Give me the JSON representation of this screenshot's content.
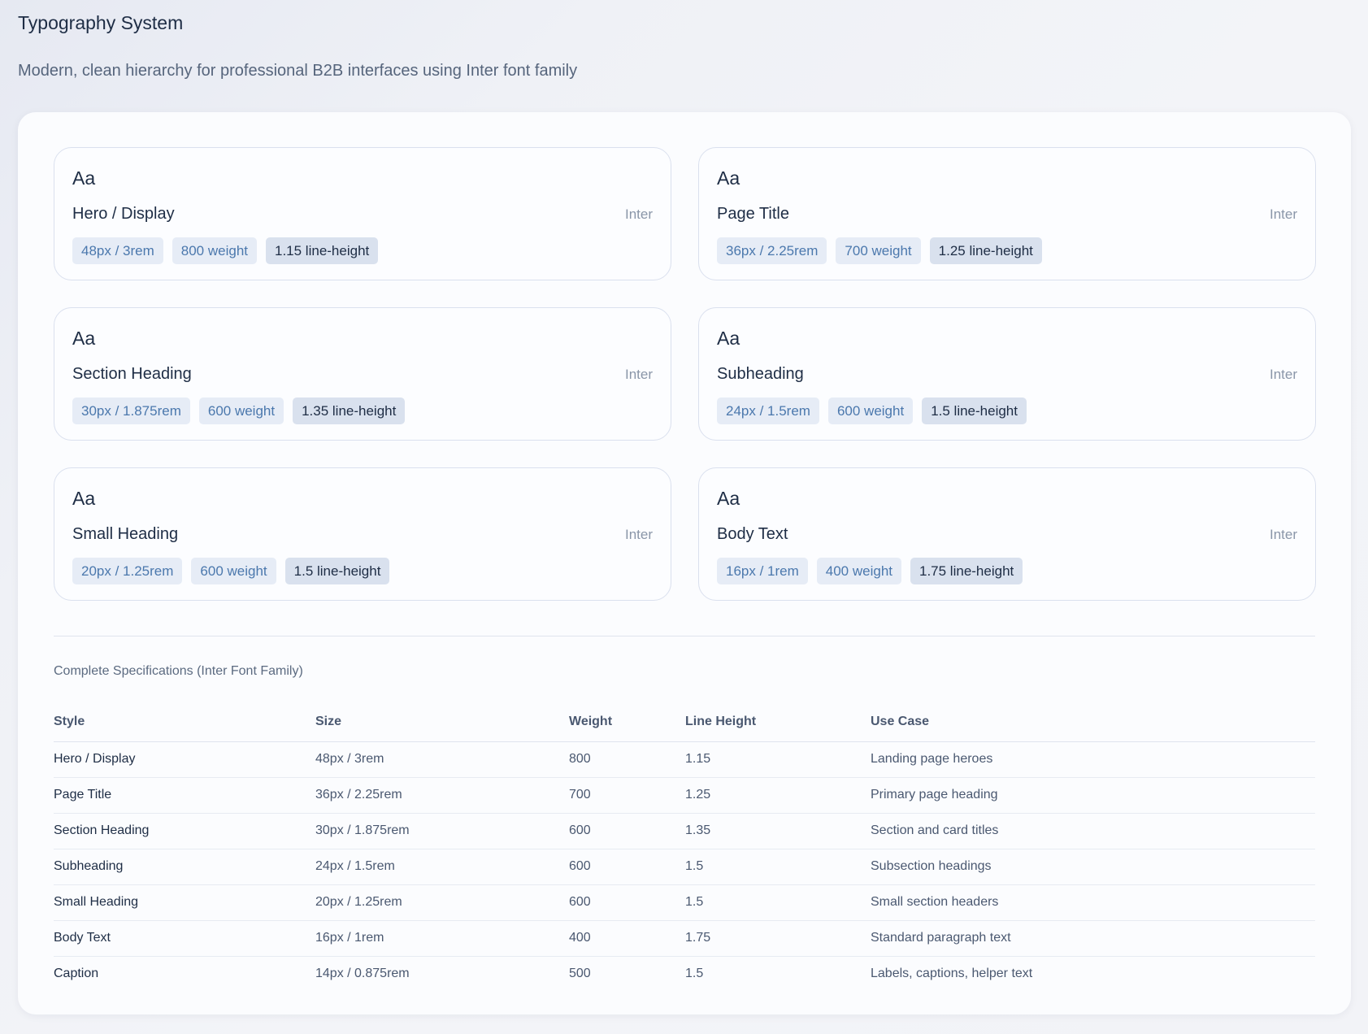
{
  "header": {
    "title": "Typography System",
    "subtitle": "Modern, clean hierarchy for professional B2B interfaces using Inter font family"
  },
  "cards": [
    {
      "sample": "Aa",
      "name": "Hero / Display",
      "font": "Inter",
      "size": "48px / 3rem",
      "weight": "800 weight",
      "line_height": "1.15 line-height"
    },
    {
      "sample": "Aa",
      "name": "Page Title",
      "font": "Inter",
      "size": "36px / 2.25rem",
      "weight": "700 weight",
      "line_height": "1.25 line-height"
    },
    {
      "sample": "Aa",
      "name": "Section Heading",
      "font": "Inter",
      "size": "30px / 1.875rem",
      "weight": "600 weight",
      "line_height": "1.35 line-height"
    },
    {
      "sample": "Aa",
      "name": "Subheading",
      "font": "Inter",
      "size": "24px / 1.5rem",
      "weight": "600 weight",
      "line_height": "1.5 line-height"
    },
    {
      "sample": "Aa",
      "name": "Small Heading",
      "font": "Inter",
      "size": "20px / 1.25rem",
      "weight": "600 weight",
      "line_height": "1.5 line-height"
    },
    {
      "sample": "Aa",
      "name": "Body Text",
      "font": "Inter",
      "size": "16px / 1rem",
      "weight": "400 weight",
      "line_height": "1.75 line-height"
    }
  ],
  "specs": {
    "title": "Complete Specifications (Inter Font Family)",
    "columns": [
      "Style",
      "Size",
      "Weight",
      "Line Height",
      "Use Case"
    ],
    "rows": [
      [
        "Hero / Display",
        "48px / 3rem",
        "800",
        "1.15",
        "Landing page heroes"
      ],
      [
        "Page Title",
        "36px / 2.25rem",
        "700",
        "1.25",
        "Primary page heading"
      ],
      [
        "Section Heading",
        "30px / 1.875rem",
        "600",
        "1.35",
        "Section and card titles"
      ],
      [
        "Subheading",
        "24px / 1.5rem",
        "600",
        "1.5",
        "Subsection headings"
      ],
      [
        "Small Heading",
        "20px / 1.25rem",
        "600",
        "1.5",
        "Small section headers"
      ],
      [
        "Body Text",
        "16px / 1rem",
        "400",
        "1.75",
        "Standard paragraph text"
      ],
      [
        "Caption",
        "14px / 0.875rem",
        "500",
        "1.5",
        "Labels, captions, helper text"
      ]
    ]
  },
  "colors": {
    "text_primary": "#1e2d45",
    "text_secondary": "#56657c",
    "tag_blue": "#4b78ad",
    "tag_bg": "#e6ecf6",
    "tag_dark_bg": "#d9e1ee",
    "border": "#dae0ee"
  }
}
